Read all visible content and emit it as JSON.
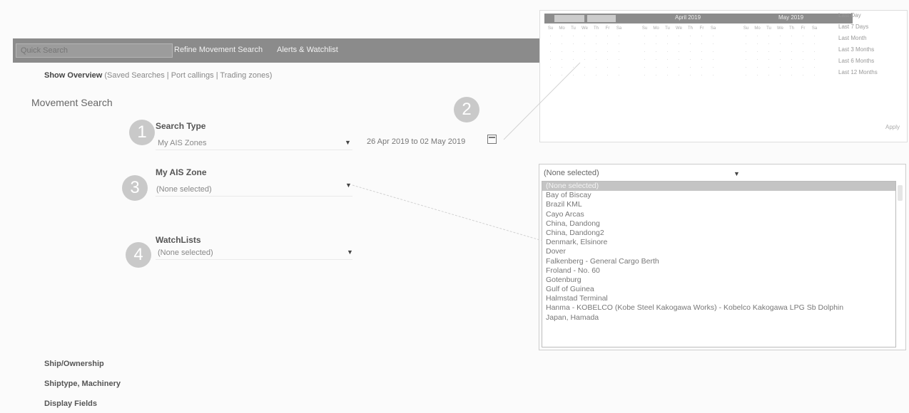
{
  "nav": {
    "quick_search_placeholder": "Quick Search",
    "links": [
      "Refine Movement Search",
      "Alerts & Watchlist"
    ]
  },
  "subnav": {
    "overview": "Show Overview",
    "links": "(Saved Searches | Port callings | Trading zones)"
  },
  "page_title": "Movement Search",
  "steps": [
    "1",
    "2",
    "3",
    "4"
  ],
  "search_type": {
    "label": "Search Type",
    "value": "My AIS Zones"
  },
  "date_range": "26 Apr 2019 to 02 May 2019",
  "ais_zone": {
    "label": "My AIS Zone",
    "value": "(None selected)"
  },
  "watchlists": {
    "label": "WatchLists",
    "value": "(None selected)"
  },
  "calendar": {
    "left_month": "April 2019",
    "right_month": "May 2019",
    "weekdays": [
      "Su",
      "Mo",
      "Tu",
      "We",
      "Th",
      "Fr",
      "Sa"
    ],
    "quick_ranges": [
      "Last Day",
      "Last 7 Days",
      "Last Month",
      "Last 3 Months",
      "Last 6 Months",
      "Last 12 Months"
    ],
    "apply": "Apply"
  },
  "zone_dropdown": {
    "selected": "(None selected)",
    "items": [
      "(None selected)",
      "Bay of Biscay",
      "Brazil KML",
      "Cayo Arcas",
      "China, Dandong",
      "China, Dandong2",
      "Denmark, Elsinore",
      "Dover",
      "Falkenberg - General Cargo Berth",
      "Froland - No. 60",
      "Gotenburg",
      "Gulf of Guinea",
      "Halmstad Terminal",
      "Hanma - KOBELCO (Kobe Steel Kakogawa Works) - Kobelco Kakogawa LPG Sb Dolphin",
      "Japan, Hamada"
    ]
  },
  "sections": [
    "Ship/Ownership",
    "Shiptype, Machinery",
    "Display Fields"
  ],
  "colors": {
    "nav_bg": "#8b8b8b",
    "step_circle": "#c9c9c9",
    "selected_row": "#c4c4c4"
  }
}
